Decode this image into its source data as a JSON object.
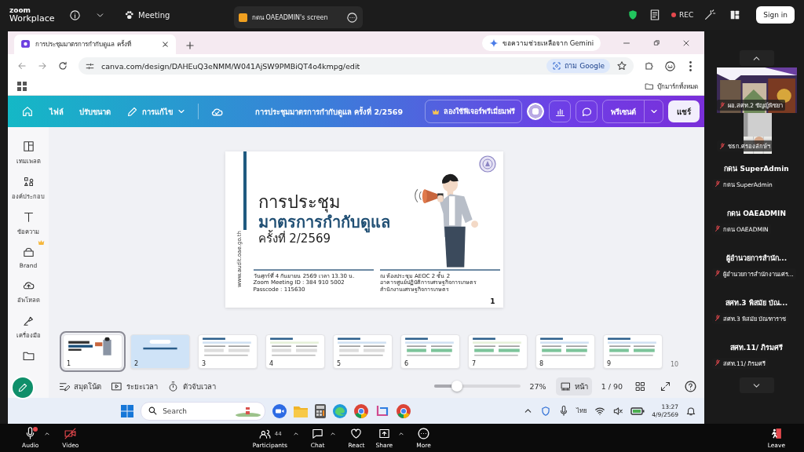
{
  "zoom_bar": {
    "logo_top": "zoom",
    "logo_bottom": "Workplace",
    "meeting": "Meeting",
    "share_tab": "กดน OAEADMIN's screen",
    "rec": "REC",
    "sign_in": "Sign in"
  },
  "browser": {
    "tab_title": "การประชุมมาตรการกำกับดูแล ครั้งที่",
    "gemini": "ขอความช่วยเหลือจาก Gemini",
    "url": "canva.com/design/DAHEuQ3eNMM/W041AjSW9PMBiQT4o4kmpg/edit",
    "ask_google": "ถาม Google",
    "bookmarks": "บุ๊กมาร์กทั้งหมด"
  },
  "canva_header": {
    "menu": [
      {
        "label": "ไฟล์"
      },
      {
        "label": "ปรับขนาด"
      },
      {
        "label": "การแก้ไข"
      }
    ],
    "title": "การประชุมมาตรการกำกับดูแล ครั้งที่ 2/2569",
    "premium": "ลองใช้ฟีเจอร์พรีเมี่ยมฟรี",
    "present": "พรีเซนต์",
    "share": "แชร์"
  },
  "rail": [
    {
      "label": "เทมเพลต",
      "premium": false
    },
    {
      "label": "องค์ประกอบ",
      "premium": false
    },
    {
      "label": "ข้อความ",
      "premium": false
    },
    {
      "label": "Brand",
      "premium": true
    },
    {
      "label": "อัพโหลด",
      "premium": false
    },
    {
      "label": "เครื่องมือ",
      "premium": false
    }
  ],
  "slide": {
    "website": "www.audit.oae.go.th",
    "title_1": "การประชุม",
    "title_2": "มาตรการกำกับดูแล",
    "title_3": "ครั้งที่ 2/2569",
    "date": "วันศุกร์ที่ 4 กันยายน 2569  เวลา 13.30 น.",
    "meeting_id": "Zoom Meeting ID : 384 910 5002",
    "passcode": "Passcode : 115630",
    "venue": [
      "ณ ห้องประชุม AEOC 2 ชั้น 2",
      "อาคารศูนย์ปฏิบัติการเศรษฐกิจการเกษตร",
      "สำนักงานเศรษฐกิจการเกษตร"
    ],
    "page": "1"
  },
  "thumbnails": [
    {
      "number": "1",
      "selected": true
    },
    {
      "number": "2",
      "selected": false
    },
    {
      "number": "3",
      "selected": false
    },
    {
      "number": "4",
      "selected": false
    },
    {
      "number": "5",
      "selected": false
    },
    {
      "number": "6",
      "selected": false
    },
    {
      "number": "7",
      "selected": false
    },
    {
      "number": "8",
      "selected": false
    },
    {
      "number": "9",
      "selected": false
    }
  ],
  "next_thumbnail": "10",
  "footer": {
    "notes": "สมุดโน้ต",
    "duration": "ระยะเวลา",
    "timer": "ตัวจับเวลา",
    "zoom_slider": {
      "level": 0.27
    },
    "zoom": "27%",
    "page_view": "หน้า",
    "page_count": "1 / 90"
  },
  "taskbar": {
    "search": "Search",
    "language": "ไทย",
    "time": "13:27",
    "date": "4/9/2569"
  },
  "participants": {
    "video_tiles": [
      {
        "name": "ผอ.สศท.2 ชัญญ์พิชยา"
      },
      {
        "name": "ชธก.ศรองลักษ์ฯ"
      }
    ],
    "tiles": [
      {
        "display": "กดน SuperAdmin",
        "label": "กดน SuperAdmin"
      },
      {
        "display": "กดน OAEADMIN",
        "label": "กดน OAEADMIN"
      },
      {
        "display": "ผู้อำนวยการสำนัก...",
        "label": "ผู้อำนวยการสำนักงานเศร..."
      },
      {
        "display": "สศท.3 พิสมัย บัณ...",
        "label": "สศท.3 พิสมัย บัณฑาราช"
      },
      {
        "display": "สศท.11/ ภิรมศรี",
        "label": "สศท.11/ ภิรมศรี"
      }
    ]
  },
  "controls": [
    {
      "label": "Audio",
      "menu": true
    },
    {
      "label": "Video",
      "menu": false
    },
    {
      "label": "Participants",
      "menu": true,
      "count": "44"
    },
    {
      "label": "Chat",
      "menu": true
    },
    {
      "label": "React",
      "menu": false
    },
    {
      "label": "Share",
      "menu": true
    },
    {
      "label": "More",
      "menu": false
    }
  ],
  "leave": "Leave"
}
